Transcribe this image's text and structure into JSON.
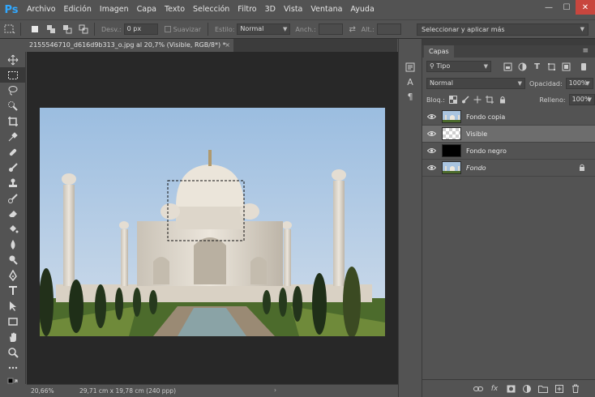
{
  "app": {
    "logo": "Ps"
  },
  "menu": [
    "Archivo",
    "Edición",
    "Imagen",
    "Capa",
    "Texto",
    "Selección",
    "Filtro",
    "3D",
    "Vista",
    "Ventana",
    "Ayuda"
  ],
  "window": {
    "minimize": "—",
    "maximize": "☐",
    "close": "✕"
  },
  "options_bar": {
    "feather_label": "Desv.:",
    "feather_value": "0 px",
    "antialias_label": "Suavizar",
    "style_label": "Estilo:",
    "style_value": "Normal",
    "width_label": "Anch.:",
    "height_label": "Alt.:",
    "select_and_mask": "Seleccionar y aplicar más"
  },
  "document": {
    "tab_title": "2155546710_d616d9b313_o.jpg al 20,7% (Visible, RGB/8*) *",
    "close": "×"
  },
  "status": {
    "zoom": "20,66%",
    "doc_size": "29,71 cm x 19,78 cm (240 ppp)",
    "arrow": "›"
  },
  "mini_panel": {
    "a_label": "A",
    "para_label": "¶"
  },
  "layers_panel": {
    "tab": "Capas",
    "kind_filter": "Tipo",
    "blend_mode": "Normal",
    "opacity_label": "Opacidad:",
    "opacity_value": "100%",
    "lock_label": "Bloq.:",
    "fill_label": "Relleno:",
    "fill_value": "100%",
    "layers": [
      {
        "name": "Fondo copia",
        "thumb": "photo",
        "selected": false,
        "italic": false,
        "locked": false
      },
      {
        "name": "Visible",
        "thumb": "transparent",
        "selected": true,
        "italic": false,
        "locked": false
      },
      {
        "name": "Fondo negro",
        "thumb": "black",
        "selected": false,
        "italic": false,
        "locked": false
      },
      {
        "name": "Fondo",
        "thumb": "photo",
        "selected": false,
        "italic": true,
        "locked": true
      }
    ],
    "footer_fx": "fx"
  },
  "colors": {
    "ui_bg": "#535353",
    "canvas_bg": "#282828",
    "selected_layer": "#6d6d6d",
    "ps_blue": "#31a8ff",
    "close_red": "#c8463e"
  }
}
